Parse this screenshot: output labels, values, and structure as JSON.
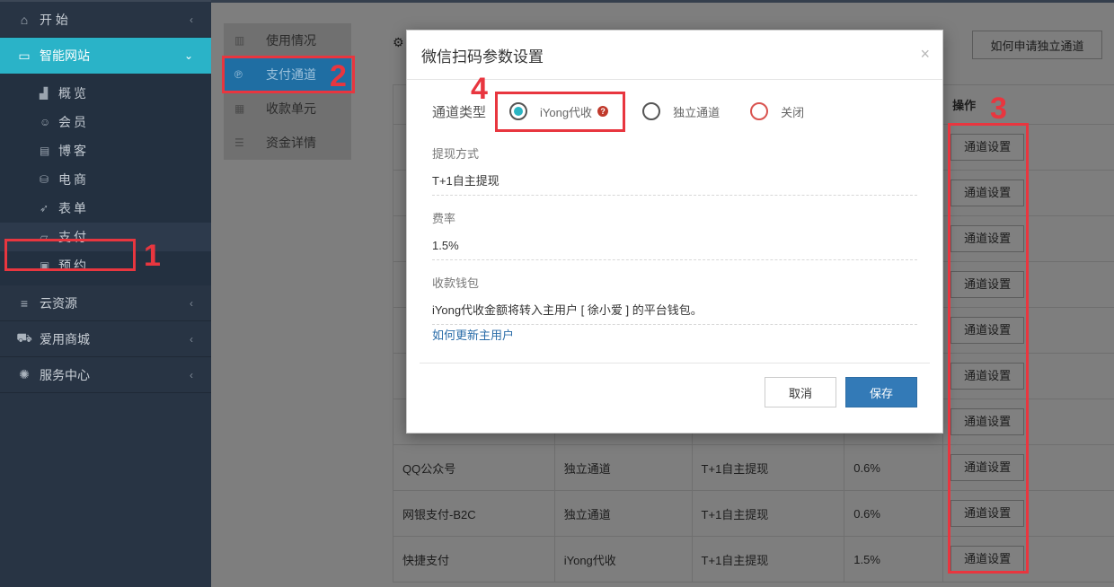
{
  "sidebar": {
    "items": [
      {
        "label": "开 始",
        "icon": "home-icon"
      },
      {
        "label": "智能网站",
        "icon": "laptop-icon"
      },
      {
        "label": "云资源",
        "icon": "menu-icon"
      },
      {
        "label": "爱用商城",
        "icon": "cart-icon"
      },
      {
        "label": "服务中心",
        "icon": "spinner-icon"
      }
    ],
    "subitems": [
      {
        "label": "概览",
        "icon": "chart-icon"
      },
      {
        "label": "会员",
        "icon": "user-icon"
      },
      {
        "label": "博客",
        "icon": "document-icon"
      },
      {
        "label": "电商",
        "icon": "bag-icon"
      },
      {
        "label": "表单",
        "icon": "send-icon"
      },
      {
        "label": "支付",
        "icon": "wallet-icon"
      },
      {
        "label": "预约",
        "icon": "calendar-icon"
      }
    ]
  },
  "subnav": {
    "items": [
      {
        "label": "使用情况"
      },
      {
        "label": "支付通道"
      },
      {
        "label": "收款单元"
      },
      {
        "label": "资金详情"
      }
    ]
  },
  "header": {
    "apply_button": "如何申请独立通道"
  },
  "table": {
    "op_header": "操作",
    "op_button": "通道设置",
    "rows": [
      {
        "name": "QQ公众号",
        "type": "独立通道",
        "withdraw": "T+1自主提现",
        "rate": "0.6%"
      },
      {
        "name": "网银支付-B2C",
        "type": "独立通道",
        "withdraw": "T+1自主提现",
        "rate": "0.6%"
      },
      {
        "name": "快捷支付",
        "type": "iYong代收",
        "withdraw": "T+1自主提现",
        "rate": "1.5%"
      }
    ]
  },
  "modal": {
    "title": "微信扫码参数设置",
    "close": "×",
    "type_label": "通道类型",
    "options": [
      {
        "label": "iYong代收",
        "checked": true
      },
      {
        "label": "独立通道",
        "checked": false
      },
      {
        "label": "关闭",
        "checked": false
      }
    ],
    "help_glyph": "?",
    "withdraw_label": "提现方式",
    "withdraw_value": "T+1自主提现",
    "rate_label": "费率",
    "rate_value": "1.5%",
    "wallet_label": "收款钱包",
    "wallet_value": "iYong代收金额将转入主用户 [ 徐小爱 ] 的平台钱包。",
    "wallet_link": "如何更新主用户",
    "cancel": "取消",
    "save": "保存"
  },
  "annotations": [
    "1",
    "2",
    "3",
    "4"
  ],
  "colors": {
    "sidebar_bg": "#283444",
    "accent": "#2ab3c8",
    "primary_button": "#337ab7",
    "annotation_red": "#e8363f"
  }
}
